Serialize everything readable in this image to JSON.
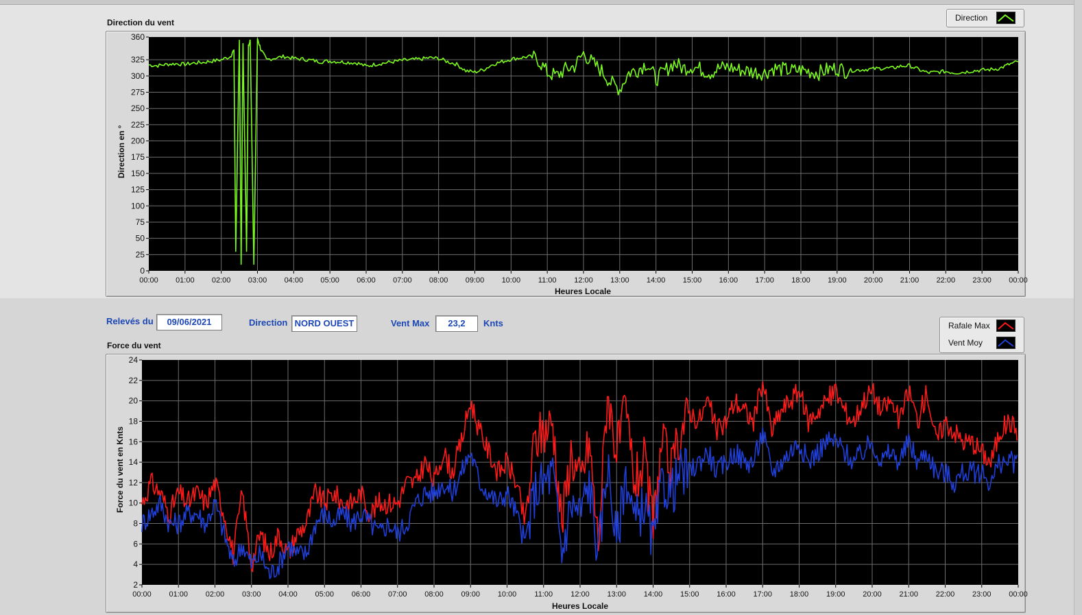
{
  "direction_chart": {
    "title": "Direction du vent",
    "ylabel": "Direction en °",
    "xlabel": "Heures Locale",
    "legend": {
      "label": "Direction",
      "color": "#7cfc1e"
    },
    "chart_data": {
      "type": "line",
      "title": "Direction du vent",
      "xlabel": "Heures Locale",
      "ylabel": "Direction en °",
      "ylim": [
        0,
        360
      ],
      "yticks": [
        0,
        25,
        50,
        75,
        100,
        125,
        150,
        175,
        200,
        225,
        250,
        275,
        300,
        325,
        360
      ],
      "xticks": [
        "00:00",
        "01:00",
        "02:00",
        "03:00",
        "04:00",
        "05:00",
        "06:00",
        "07:00",
        "08:00",
        "09:00",
        "10:00",
        "11:00",
        "12:00",
        "13:00",
        "14:00",
        "15:00",
        "16:00",
        "17:00",
        "18:00",
        "19:00",
        "20:00",
        "21:00",
        "22:00",
        "23:00",
        "00:00"
      ],
      "grid": true,
      "series": [
        {
          "name": "Direction",
          "color": "#7cfc1e",
          "x_hours": [
            0,
            0.25,
            0.5,
            0.75,
            1,
            1.25,
            1.5,
            1.75,
            2,
            2.25,
            2.35,
            2.4,
            2.5,
            2.55,
            2.6,
            2.7,
            2.75,
            2.8,
            2.9,
            3,
            3.1,
            3.25,
            3.5,
            3.75,
            4,
            4.25,
            4.5,
            4.75,
            5,
            5.25,
            5.5,
            5.75,
            6,
            6.25,
            6.5,
            6.75,
            7,
            7.25,
            7.5,
            7.75,
            8,
            8.25,
            8.5,
            8.75,
            9,
            9.25,
            9.5,
            9.75,
            10,
            10.25,
            10.5,
            10.75,
            11,
            11.25,
            11.5,
            11.75,
            12,
            12.25,
            12.5,
            12.75,
            13,
            13.25,
            13.5,
            13.75,
            14,
            14.25,
            14.5,
            14.75,
            15,
            15.25,
            15.5,
            15.75,
            16,
            16.25,
            16.5,
            16.75,
            17,
            17.25,
            17.5,
            17.75,
            18,
            18.25,
            18.5,
            18.75,
            19,
            19.25,
            19.5,
            19.75,
            20,
            20.25,
            20.5,
            20.75,
            21,
            21.25,
            21.5,
            21.75,
            22,
            22.25,
            22.5,
            22.75,
            23,
            23.25,
            23.5,
            23.75,
            24
          ],
          "values": [
            317,
            316,
            318,
            319,
            318,
            320,
            321,
            323,
            325,
            330,
            340,
            30,
            355,
            10,
            350,
            30,
            345,
            355,
            10,
            358,
            340,
            325,
            328,
            330,
            327,
            326,
            324,
            322,
            323,
            322,
            321,
            320,
            315,
            318,
            320,
            322,
            324,
            325,
            326,
            328,
            327,
            322,
            318,
            308,
            306,
            310,
            318,
            322,
            326,
            328,
            330,
            325,
            305,
            300,
            310,
            315,
            335,
            320,
            308,
            290,
            280,
            305,
            310,
            320,
            295,
            308,
            320,
            312,
            315,
            310,
            305,
            312,
            314,
            310,
            308,
            306,
            305,
            312,
            310,
            308,
            309,
            307,
            305,
            310,
            312,
            308,
            309,
            310,
            311,
            312,
            312,
            315,
            316,
            310,
            305,
            306,
            307,
            305,
            306,
            308,
            309,
            310,
            312,
            318,
            322
          ]
        }
      ]
    }
  },
  "info": {
    "date_label": "Relevés du",
    "date_value": "09/06/2021",
    "direction_label": "Direction",
    "direction_value": "NORD OUEST",
    "ventmax_label": "Vent Max",
    "ventmax_value": "23,2",
    "ventmax_unit": "Knts"
  },
  "force_chart": {
    "title": "Force du vent",
    "ylabel": "Force du vent en Knts",
    "xlabel": "Heures Locale",
    "legend": [
      {
        "label": "Rafale Max",
        "color": "#ff1a1a"
      },
      {
        "label": "Vent Moy",
        "color": "#1f3fd6"
      }
    ],
    "chart_data": {
      "type": "line",
      "title": "Force du vent",
      "xlabel": "Heures Locale",
      "ylabel": "Force du vent en Knts",
      "ylim": [
        2,
        24
      ],
      "yticks": [
        2,
        4,
        6,
        8,
        10,
        12,
        14,
        16,
        18,
        20,
        22,
        24
      ],
      "xticks": [
        "00:00",
        "01:00",
        "02:00",
        "03:00",
        "04:00",
        "05:00",
        "06:00",
        "07:00",
        "08:00",
        "09:00",
        "10:00",
        "11:00",
        "12:00",
        "13:00",
        "14:00",
        "15:00",
        "16:00",
        "17:00",
        "18:00",
        "19:00",
        "20:00",
        "21:00",
        "22:00",
        "23:00",
        "00:00"
      ],
      "grid": true,
      "series": [
        {
          "name": "Rafale Max",
          "color": "#ff1a1a",
          "x_hours": [
            0,
            0.25,
            0.5,
            0.75,
            1,
            1.25,
            1.5,
            1.75,
            2,
            2.25,
            2.5,
            2.75,
            3,
            3.25,
            3.5,
            3.75,
            4,
            4.25,
            4.5,
            4.75,
            5,
            5.25,
            5.5,
            5.75,
            6,
            6.25,
            6.5,
            6.75,
            7,
            7.25,
            7.5,
            7.75,
            8,
            8.25,
            8.5,
            8.75,
            9,
            9.25,
            9.5,
            9.75,
            10,
            10.25,
            10.5,
            10.75,
            11,
            11.25,
            11.5,
            11.75,
            12,
            12.25,
            12.5,
            12.75,
            13,
            13.25,
            13.5,
            13.75,
            14,
            14.25,
            14.5,
            14.75,
            15,
            15.25,
            15.5,
            15.75,
            16,
            16.25,
            16.5,
            16.75,
            17,
            17.25,
            17.5,
            17.75,
            18,
            18.25,
            18.5,
            18.75,
            19,
            19.25,
            19.5,
            19.75,
            20,
            20.25,
            20.5,
            20.75,
            21,
            21.25,
            21.5,
            21.75,
            22,
            22.25,
            22.5,
            22.75,
            23,
            23.25,
            23.5,
            23.75,
            24
          ],
          "values": [
            10,
            12,
            11,
            9,
            11,
            10,
            11,
            10,
            12,
            9,
            5,
            11,
            4,
            7,
            5,
            7,
            5,
            7,
            8,
            11,
            10,
            11,
            10,
            10,
            11,
            9,
            10,
            10,
            10,
            12,
            12,
            14,
            12,
            15,
            13,
            16,
            20,
            17,
            15,
            13,
            14,
            12,
            8,
            16,
            17,
            18,
            8,
            15,
            12,
            16,
            6,
            21,
            15,
            19,
            12,
            14,
            8,
            16,
            13,
            17,
            19,
            18,
            20,
            17,
            18,
            20,
            19,
            18,
            22,
            17,
            19,
            20,
            21,
            18,
            19,
            20,
            21,
            19,
            18,
            20,
            21,
            19,
            20,
            18,
            21,
            18,
            21,
            16,
            18,
            17,
            16,
            16,
            15,
            14,
            17,
            18,
            17,
            16,
            14
          ]
        },
        {
          "name": "Vent Moy",
          "color": "#1f3fd6",
          "x_hours": [
            0,
            0.25,
            0.5,
            0.75,
            1,
            1.25,
            1.5,
            1.75,
            2,
            2.25,
            2.5,
            2.75,
            3,
            3.25,
            3.5,
            3.75,
            4,
            4.25,
            4.5,
            4.75,
            5,
            5.25,
            5.5,
            5.75,
            6,
            6.25,
            6.5,
            6.75,
            7,
            7.25,
            7.5,
            7.75,
            8,
            8.25,
            8.5,
            8.75,
            9,
            9.25,
            9.5,
            9.75,
            10,
            10.25,
            10.5,
            10.75,
            11,
            11.25,
            11.5,
            11.75,
            12,
            12.25,
            12.5,
            12.75,
            13,
            13.25,
            13.5,
            13.75,
            14,
            14.25,
            14.5,
            14.75,
            15,
            15.25,
            15.5,
            15.75,
            16,
            16.25,
            16.5,
            16.75,
            17,
            17.25,
            17.5,
            17.75,
            18,
            18.25,
            18.5,
            18.75,
            19,
            19.25,
            19.5,
            19.75,
            20,
            20.25,
            20.5,
            20.75,
            21,
            21.25,
            21.5,
            21.75,
            22,
            22.25,
            22.5,
            22.75,
            23,
            23.25,
            23.5,
            23.75,
            24
          ],
          "values": [
            8,
            9,
            10,
            8,
            8,
            9,
            9,
            8,
            10,
            7,
            4,
            6,
            4,
            5,
            3,
            4,
            6,
            5,
            5,
            8,
            9,
            8,
            9,
            8,
            9,
            8,
            7,
            8,
            7,
            8,
            10,
            11,
            11,
            12,
            11,
            13,
            15,
            12,
            11,
            10,
            11,
            9,
            6,
            11,
            12,
            13,
            5,
            10,
            9,
            12,
            5,
            14,
            6,
            13,
            8,
            10,
            6,
            12,
            11,
            13,
            13,
            14,
            15,
            13,
            14,
            15,
            14,
            14,
            17,
            13,
            14,
            15,
            16,
            14,
            15,
            16,
            16,
            15,
            14,
            15,
            16,
            14,
            15,
            14,
            16,
            14,
            15,
            13,
            13,
            12,
            13,
            13,
            13,
            12,
            14,
            14,
            14,
            13,
            12
          ]
        }
      ]
    }
  }
}
